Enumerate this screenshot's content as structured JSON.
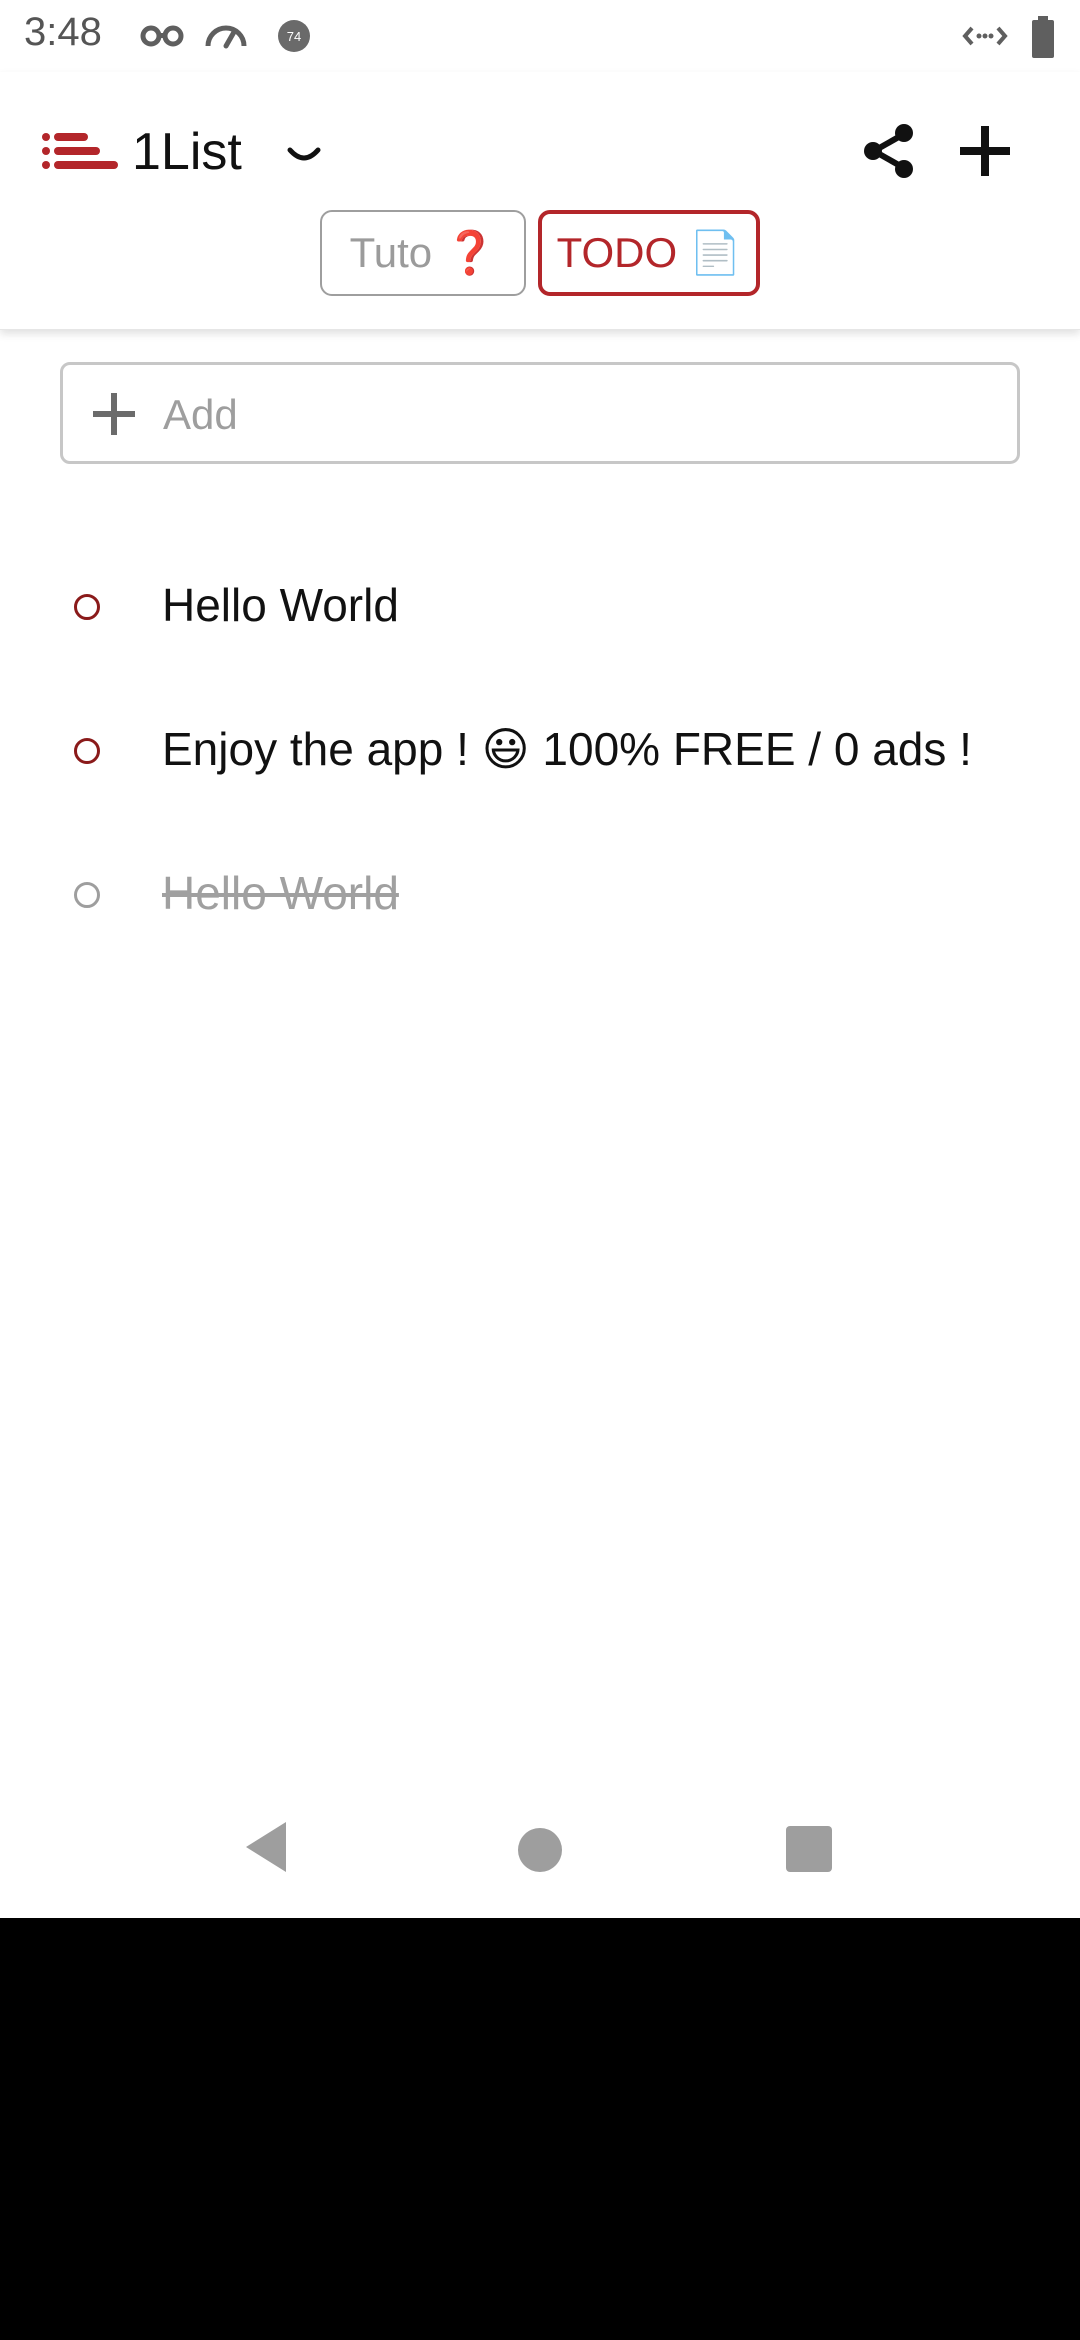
{
  "status_bar": {
    "time": "3:48",
    "icons_left": [
      "incognito-icon",
      "speedometer-icon",
      "notification-badge-icon"
    ],
    "notification_badge": "74",
    "icons_right": [
      "data-saver-icon",
      "battery-icon"
    ]
  },
  "header": {
    "logo": "list-logo-icon",
    "title": "1List",
    "dropdown": "chevron-down-icon",
    "actions": [
      "share-icon",
      "plus-icon"
    ]
  },
  "tabs": [
    {
      "label": "Tuto",
      "emoji": "❓",
      "active": false
    },
    {
      "label": "TODO",
      "emoji": "📄",
      "active": true
    }
  ],
  "add_field": {
    "placeholder": "Add",
    "value": ""
  },
  "items": [
    {
      "text": "Hello World",
      "done": false
    },
    {
      "text": "Enjoy the app ! 😃 100% FREE / 0 ads !",
      "done": false
    },
    {
      "text": "Hello World",
      "done": true
    }
  ],
  "colors": {
    "accent": "#b3262a",
    "circle": "#8a1a1a",
    "muted": "#9e9e9e"
  },
  "nav_bar": [
    "back-icon",
    "home-icon",
    "recents-icon"
  ]
}
